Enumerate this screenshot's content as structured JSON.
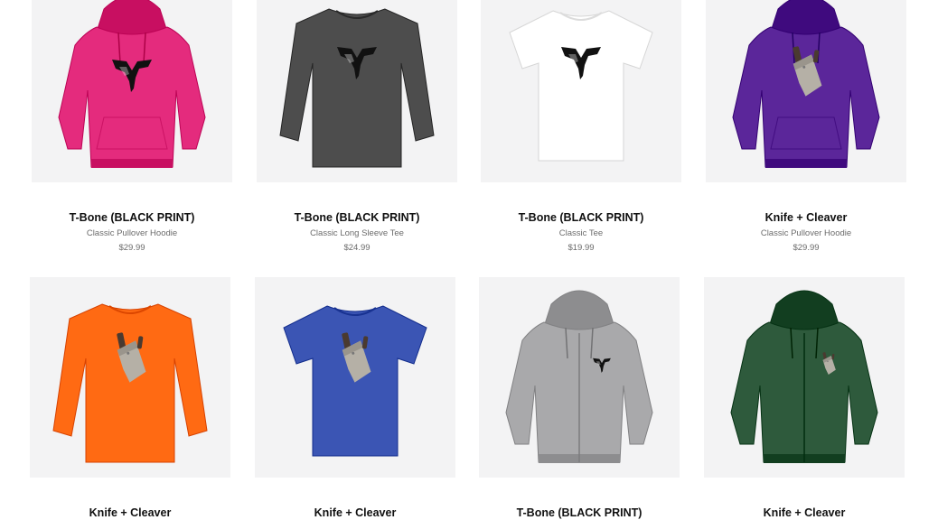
{
  "products": [
    {
      "title": "T-Bone (BLACK PRINT)",
      "style": "Classic Pullover Hoodie",
      "price": "$29.99",
      "garment": "hoodie",
      "color": "#e42b7d",
      "print": "tbone-logo",
      "print_color": "#111111"
    },
    {
      "title": "T-Bone (BLACK PRINT)",
      "style": "Classic Long Sleeve Tee",
      "price": "$24.99",
      "garment": "longsleeve",
      "color": "#4d4d4d",
      "print": "tbone-logo",
      "print_color": "#111111"
    },
    {
      "title": "T-Bone (BLACK PRINT)",
      "style": "Classic Tee",
      "price": "$19.99",
      "garment": "tee",
      "color": "#ffffff",
      "print": "tbone-logo",
      "print_color": "#111111"
    },
    {
      "title": "Knife + Cleaver",
      "style": "Classic Pullover Hoodie",
      "price": "$29.99",
      "garment": "hoodie",
      "color": "#5b269a",
      "print": "cleaver",
      "print_color": "#b5b0a6"
    },
    {
      "title": "Knife + Cleaver",
      "style": "",
      "price": "",
      "garment": "longsleeve",
      "color": "#ff6a13",
      "print": "cleaver",
      "print_color": "#b5b0a6"
    },
    {
      "title": "Knife + Cleaver",
      "style": "",
      "price": "",
      "garment": "tee",
      "color": "#3b55b4",
      "print": "cleaver",
      "print_color": "#b5b0a6"
    },
    {
      "title": "T-Bone (BLACK PRINT)",
      "style": "",
      "price": "",
      "garment": "zip-hoodie",
      "color": "#a9a9ab",
      "print": "tbone-logo",
      "print_color": "#111111"
    },
    {
      "title": "Knife + Cleaver",
      "style": "",
      "price": "",
      "garment": "zip-hoodie",
      "color": "#2e5a3c",
      "print": "cleaver",
      "print_color": "#b5b0a6"
    }
  ]
}
